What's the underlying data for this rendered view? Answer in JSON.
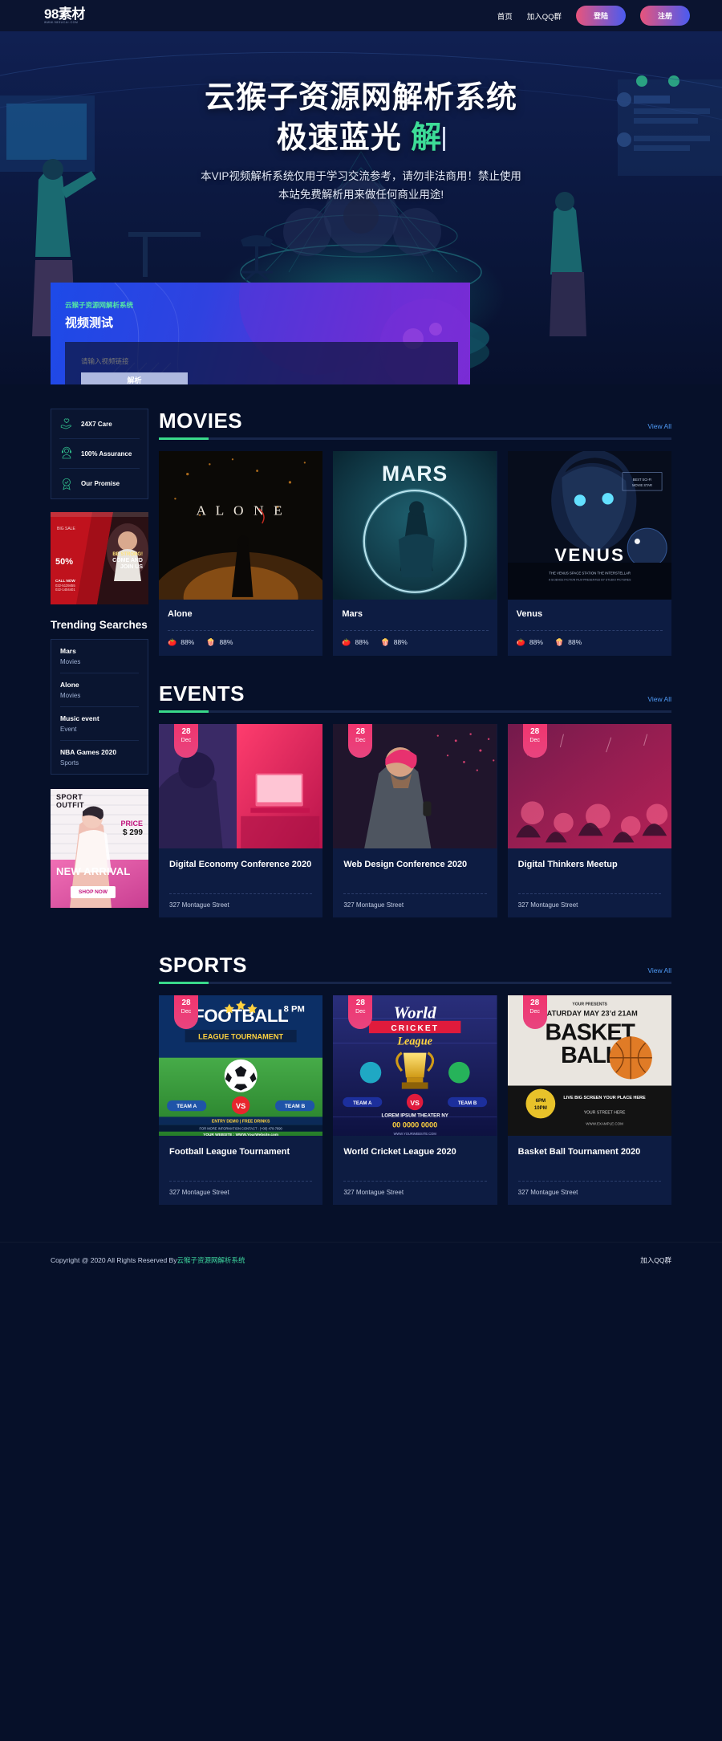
{
  "header": {
    "logo_main": "98素材",
    "logo_sub": "WWW.98SUCAI.COM",
    "nav": [
      {
        "label": "首页"
      },
      {
        "label": "加入QQ群"
      }
    ],
    "login_label": "登陆",
    "register_label": "注册"
  },
  "hero": {
    "title_line1": "云猴子资源网解析系统",
    "title_line2_static": "极速蓝光 ",
    "title_line2_typed": "解",
    "subtitle_line1": "本VIP视频解析系统仅用于学习交流参考，请勿非法商用！禁止使用",
    "subtitle_line2": "本站免费解析用来做任何商业用途!"
  },
  "parser": {
    "eyebrow": "云猴子资源网解析系统",
    "title": "视频测试",
    "input_placeholder": "请输入视频链接",
    "input_value": "",
    "submit_label": "解析"
  },
  "sidebar": {
    "features": [
      {
        "label": "24X7 Care",
        "icon": "heart-in-hand-icon"
      },
      {
        "label": "100% Assurance",
        "icon": "agent-support-icon"
      },
      {
        "label": "Our Promise",
        "icon": "promise-badge-icon"
      }
    ],
    "ad_top": {
      "discount": "50%",
      "line1": "BE STRONG!",
      "line2": "COME AND",
      "line3": "JOIN US",
      "call": "CALL NOW",
      "phone1": "022-5139455",
      "phone2": "022-1404401"
    },
    "trending_heading": "Trending Searches",
    "trending": [
      {
        "title": "Mars",
        "category": "Movies"
      },
      {
        "title": "Alone",
        "category": "Movies"
      },
      {
        "title": "Music event",
        "category": "Event"
      },
      {
        "title": "NBA Games 2020",
        "category": "Sports"
      }
    ],
    "ad_bottom": {
      "line1": "SPORT",
      "line2": "OUTFIT",
      "price_label": "PRICE",
      "price_value": "$ 299",
      "headline": "NEW ARRIVAL",
      "cta": "SHOP NOW"
    }
  },
  "sections": [
    {
      "id": "movies",
      "title": "MOVIES",
      "view_all": "View All",
      "type": "movies",
      "cards": [
        {
          "title": "Alone",
          "poster_text": "A L O N E",
          "tomato_label": "88%",
          "popcorn_label": "88%"
        },
        {
          "title": "Mars",
          "poster_text": "MARS",
          "tomato_label": "88%",
          "popcorn_label": "88%"
        },
        {
          "title": "Venus",
          "poster_text": "VENUS",
          "tomato_label": "88%",
          "popcorn_label": "88%"
        }
      ]
    },
    {
      "id": "events",
      "title": "EVENTS",
      "view_all": "View All",
      "type": "events",
      "cards": [
        {
          "day": "28",
          "month": "Dec",
          "title": "Digital Economy Conference 2020",
          "address": "327 Montague Street"
        },
        {
          "day": "28",
          "month": "Dec",
          "title": "Web Design Conference 2020",
          "address": "327 Montague Street"
        },
        {
          "day": "28",
          "month": "Dec",
          "title": "Digital Thinkers Meetup",
          "address": "327 Montague Street"
        }
      ]
    },
    {
      "id": "sports",
      "title": "SPORTS",
      "view_all": "View All",
      "type": "sports",
      "cards": [
        {
          "day": "28",
          "month": "Dec",
          "title": "Football League Tournament",
          "address": "327 Montague Street",
          "poster_main": "FOOTBALL",
          "poster_sub": "LEAGUE TOURNAMENT",
          "poster_time": "8 PM"
        },
        {
          "day": "28",
          "month": "Dec",
          "title": "World Cricket League 2020",
          "address": "327 Montague Street",
          "poster_main": "World",
          "poster_sub": "CRICKET",
          "poster_sub2": "League"
        },
        {
          "day": "28",
          "month": "Dec",
          "title": "Basket Ball Tournament 2020",
          "address": "327 Montague Street",
          "poster_main": "BASKET BALL",
          "poster_sub": "SATURDAY MAY 23rd 21AM",
          "poster_time": "6PM 10PM"
        }
      ]
    }
  ],
  "footer": {
    "copyright": "Copyright @ 2020 All Rights Reserved By ",
    "brand_link": "云猴子资源网解析系统",
    "qq_link": "加入QQ群"
  },
  "colors": {
    "bg": "#061029",
    "card": "#0d1c42",
    "accent_green": "#39d98a",
    "accent_blue": "#4f9af5",
    "badge_pink": "#f0356e"
  }
}
